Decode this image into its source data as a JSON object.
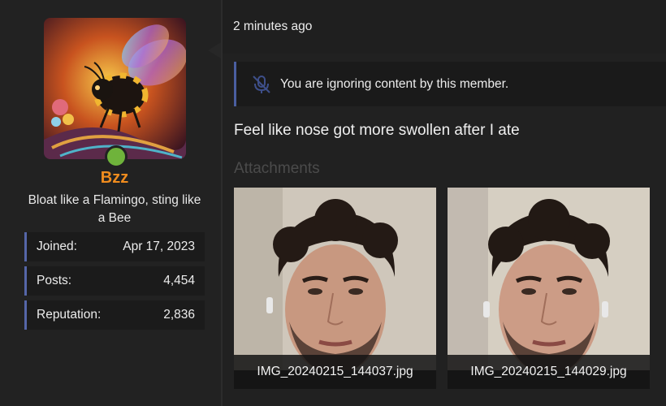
{
  "user": {
    "name": "Bzz",
    "title": "Bloat like a Flamingo, sting like a Bee",
    "stats": [
      {
        "label": "Joined:",
        "value": "Apr 17, 2023"
      },
      {
        "label": "Posts:",
        "value": "4,454"
      },
      {
        "label": "Reputation:",
        "value": "2,836"
      }
    ],
    "status_color": "#6fb33b",
    "name_color": "#f08c1e"
  },
  "post": {
    "time": "2 minutes ago",
    "ignore_notice": "You are ignoring content by this member.",
    "ignore_icon": "muted-microphone-icon",
    "message": "Feel like nose got more swollen after I ate",
    "attachments_label": "Attachments",
    "attachments": [
      {
        "filename": "IMG_20240215_144037.jpg"
      },
      {
        "filename": "IMG_20240215_144029.jpg"
      }
    ]
  },
  "colors": {
    "accent": "#4a5ea0",
    "background": "#1f1f1f"
  }
}
